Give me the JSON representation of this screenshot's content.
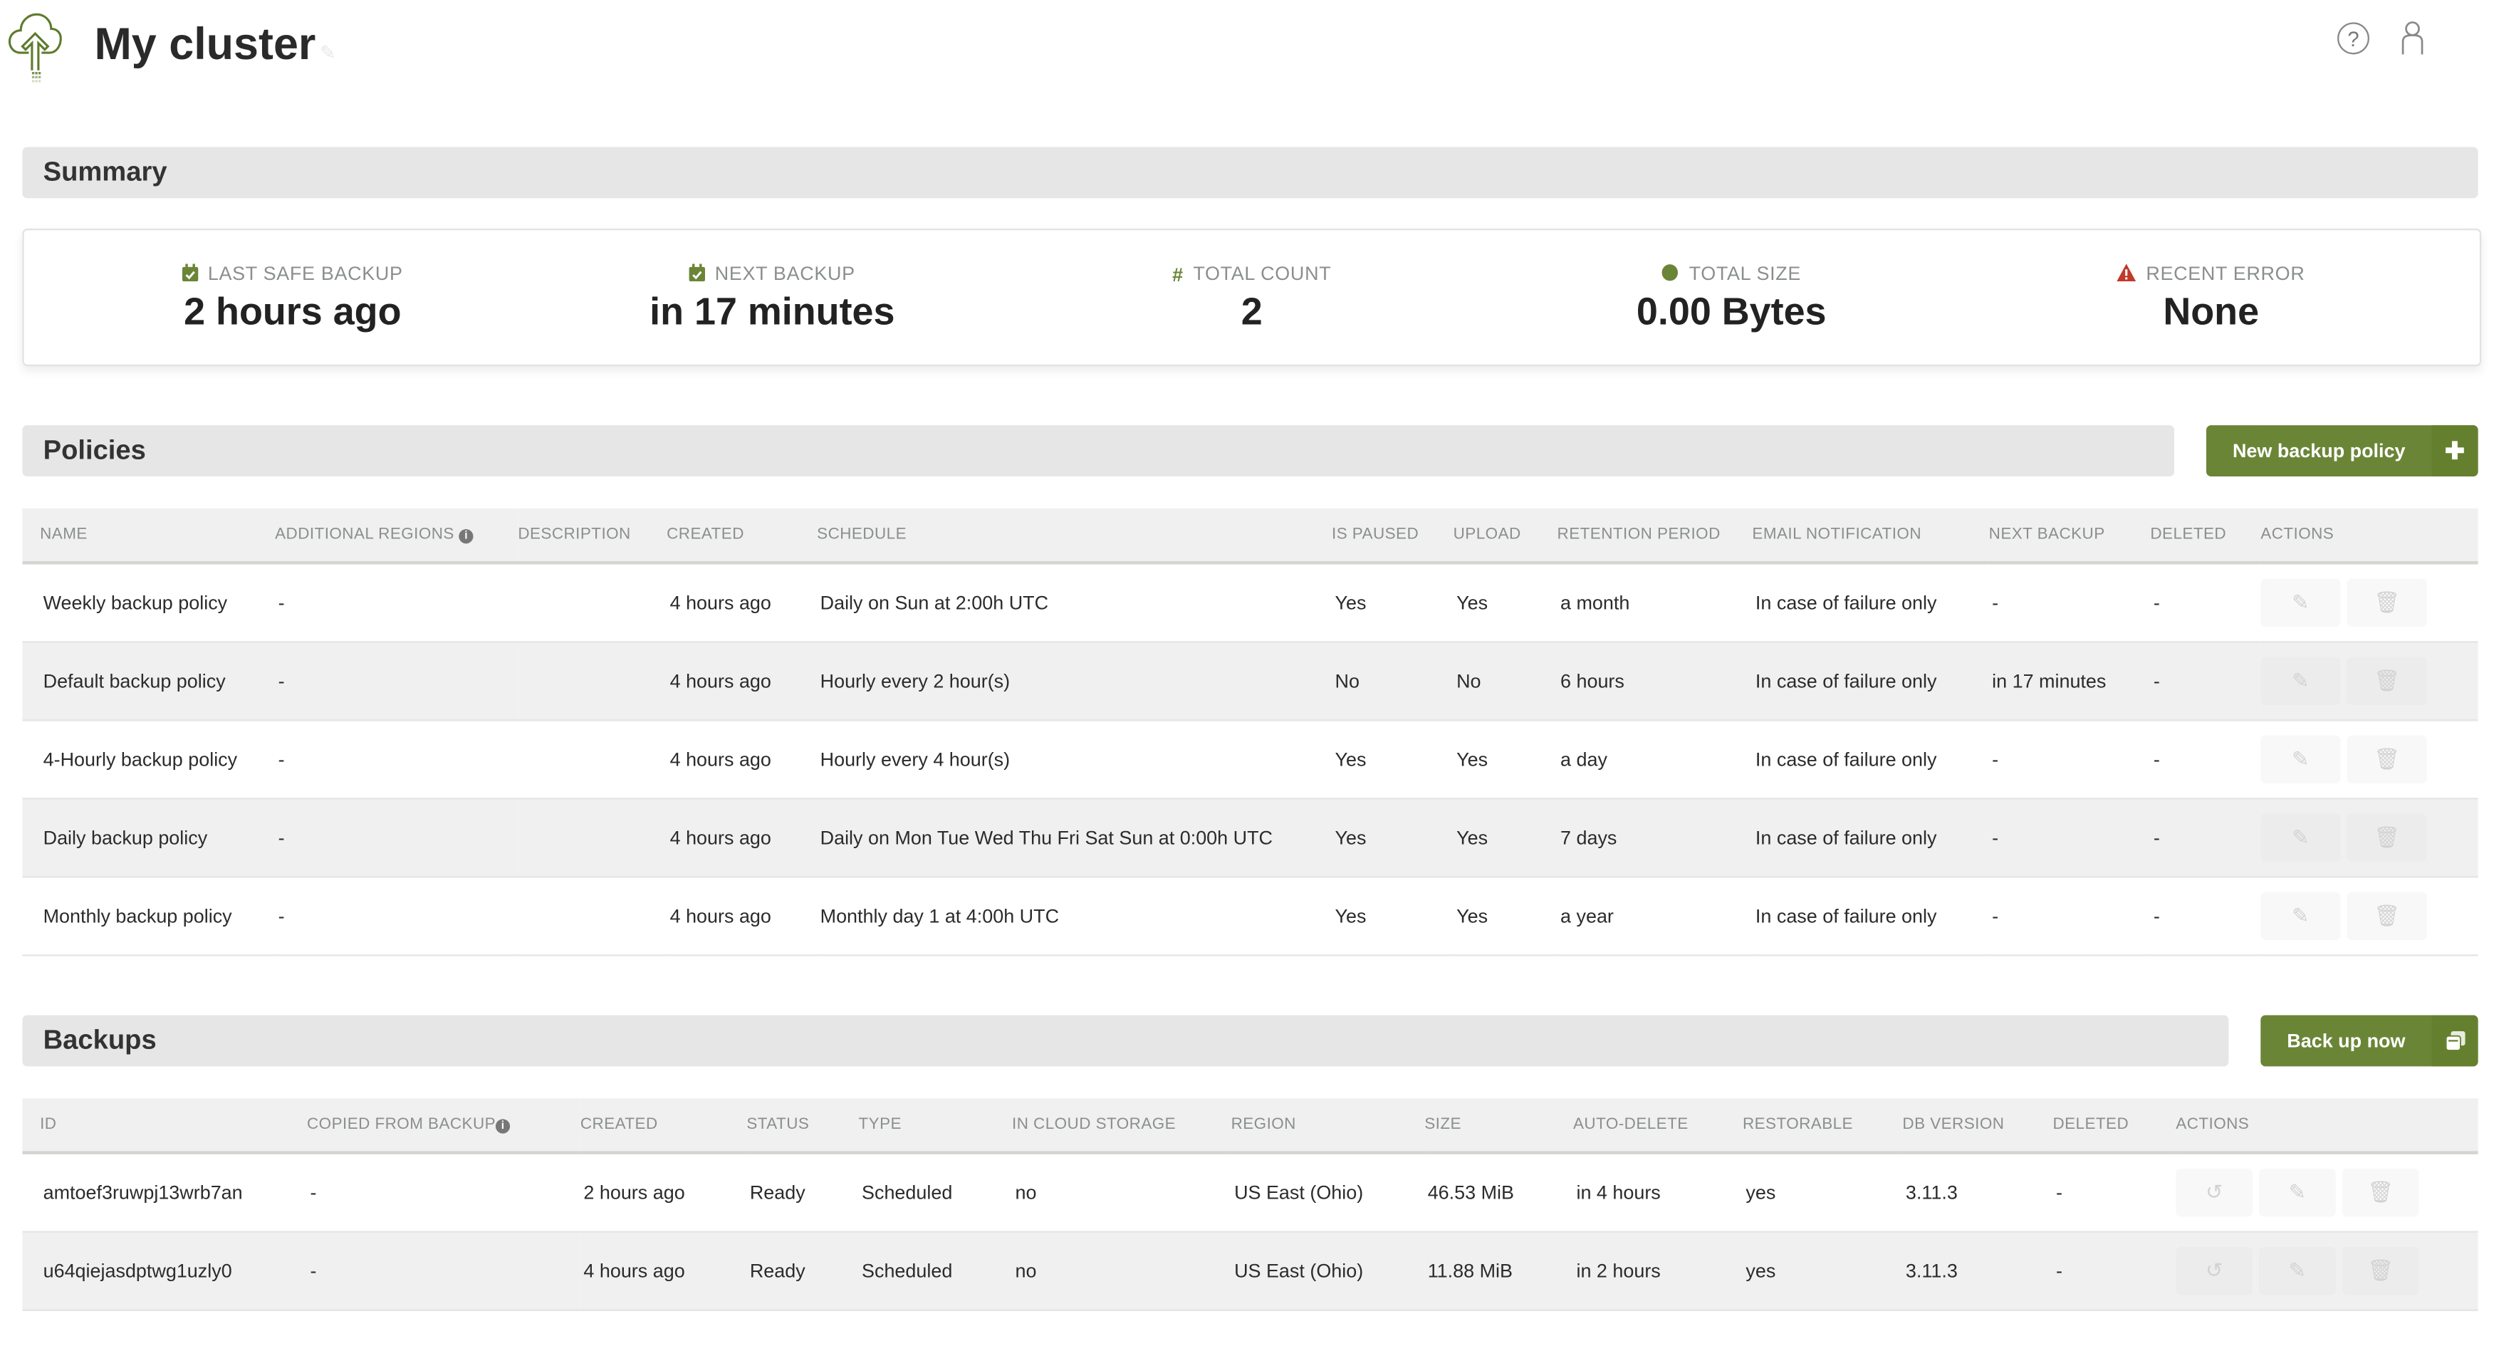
{
  "header": {
    "title": "My cluster",
    "logo_icon": "cloud-upload-icon",
    "edit_icon": "pencil-icon",
    "help_icon": "question-circle-icon",
    "user_icon": "user-icon"
  },
  "summary": {
    "title": "Summary",
    "stats": [
      {
        "label": "LAST SAFE BACKUP",
        "value": "2 hours ago",
        "icon": "calendar-check-icon"
      },
      {
        "label": "NEXT BACKUP",
        "value": "in 17 minutes",
        "icon": "calendar-check-icon"
      },
      {
        "label": "TOTAL COUNT",
        "value": "2",
        "icon": "hash-icon"
      },
      {
        "label": "TOTAL SIZE",
        "value": "0.00 Bytes",
        "icon": "database-icon"
      },
      {
        "label": "RECENT ERROR",
        "value": "None",
        "icon": "warning-icon"
      }
    ]
  },
  "colors": {
    "accent": "#6b8537",
    "error": "#c0392b",
    "section_bg": "#e6e6e6",
    "header_bg": "#f0f0f0"
  },
  "policies": {
    "title": "Policies",
    "new_button": "New backup policy",
    "new_button_icon": "plus-icon",
    "columns": [
      "NAME",
      "ADDITIONAL REGIONS",
      "DESCRIPTION",
      "CREATED",
      "SCHEDULE",
      "IS PAUSED",
      "UPLOAD",
      "RETENTION PERIOD",
      "EMAIL NOTIFICATION",
      "NEXT BACKUP",
      "DELETED",
      "ACTIONS"
    ],
    "rows": [
      {
        "name": "Weekly backup policy",
        "regions": "-",
        "description": "",
        "created": "4 hours ago",
        "schedule": "Daily on Sun at 2:00h UTC",
        "paused": "Yes",
        "upload": "Yes",
        "retention": "a month",
        "email": "In case of failure only",
        "next": "-",
        "deleted": "-"
      },
      {
        "name": "Default backup policy",
        "regions": "-",
        "description": "",
        "created": "4 hours ago",
        "schedule": "Hourly every 2 hour(s)",
        "paused": "No",
        "upload": "No",
        "retention": "6 hours",
        "email": "In case of failure only",
        "next": "in 17 minutes",
        "deleted": "-"
      },
      {
        "name": "4-Hourly backup policy",
        "regions": "-",
        "description": "",
        "created": "4 hours ago",
        "schedule": "Hourly every 4 hour(s)",
        "paused": "Yes",
        "upload": "Yes",
        "retention": "a day",
        "email": "In case of failure only",
        "next": "-",
        "deleted": "-"
      },
      {
        "name": "Daily backup policy",
        "regions": "-",
        "description": "",
        "created": "4 hours ago",
        "schedule": "Daily on Mon Tue Wed Thu Fri Sat Sun at 0:00h UTC",
        "paused": "Yes",
        "upload": "Yes",
        "retention": "7 days",
        "email": "In case of failure only",
        "next": "-",
        "deleted": "-"
      },
      {
        "name": "Monthly backup policy",
        "regions": "-",
        "description": "",
        "created": "4 hours ago",
        "schedule": "Monthly day 1 at 4:00h UTC",
        "paused": "Yes",
        "upload": "Yes",
        "retention": "a year",
        "email": "In case of failure only",
        "next": "-",
        "deleted": "-"
      }
    ]
  },
  "backups": {
    "title": "Backups",
    "backup_button": "Back up now",
    "backup_button_icon": "copy-icon",
    "columns": [
      "ID",
      "COPIED FROM BACKUP",
      "CREATED",
      "STATUS",
      "TYPE",
      "IN CLOUD STORAGE",
      "REGION",
      "SIZE",
      "AUTO-DELETE",
      "RESTORABLE",
      "DB VERSION",
      "DELETED",
      "ACTIONS"
    ],
    "rows": [
      {
        "id": "amtoef3ruwpj13wrb7an",
        "copied": "-",
        "created": "2 hours ago",
        "status": "Ready",
        "type": "Scheduled",
        "cloud": "no",
        "region": "US East (Ohio)",
        "size": "46.53 MiB",
        "autodelete": "in 4 hours",
        "restorable": "yes",
        "dbversion": "3.11.3",
        "deleted": "-"
      },
      {
        "id": "u64qiejasdptwg1uzly0",
        "copied": "-",
        "created": "4 hours ago",
        "status": "Ready",
        "type": "Scheduled",
        "cloud": "no",
        "region": "US East (Ohio)",
        "size": "11.88 MiB",
        "autodelete": "in 2 hours",
        "restorable": "yes",
        "dbversion": "3.11.3",
        "deleted": "-"
      }
    ]
  }
}
